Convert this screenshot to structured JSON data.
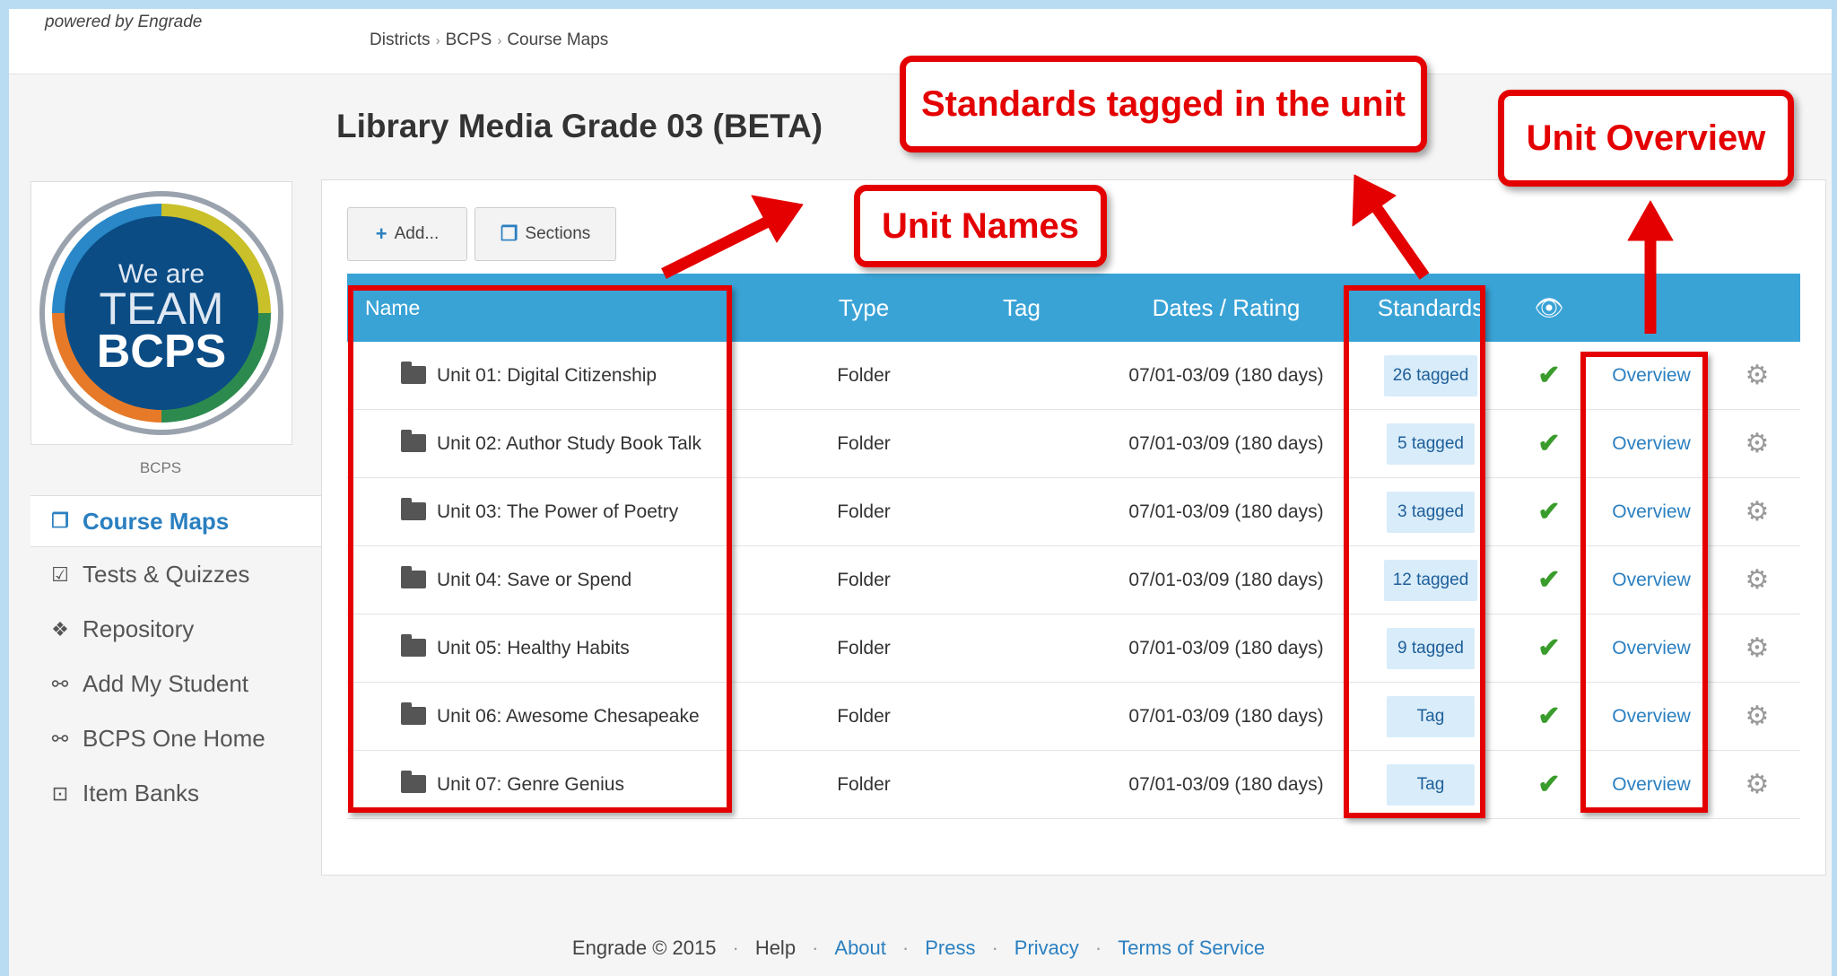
{
  "powered_by": "powered by Engrade",
  "breadcrumb": {
    "items": [
      "Districts",
      "BCPS",
      "Course Maps"
    ]
  },
  "page_title": "Library Media Grade 03 (BETA)",
  "logo": {
    "line1": "We are",
    "line2": "TEAM",
    "line3": "BCPS",
    "caption": "BCPS"
  },
  "sidebar": {
    "items": [
      {
        "label": "Course Maps",
        "icon": "pages-icon",
        "active": true
      },
      {
        "label": "Tests & Quizzes",
        "icon": "checkbox-icon"
      },
      {
        "label": "Repository",
        "icon": "dropbox-icon"
      },
      {
        "label": "Add My Student",
        "icon": "link-icon"
      },
      {
        "label": "BCPS One Home",
        "icon": "link-icon"
      },
      {
        "label": "Item Banks",
        "icon": "safe-icon"
      }
    ]
  },
  "toolbar": {
    "add_label": "Add...",
    "sections_label": "Sections"
  },
  "table": {
    "headers": {
      "name": "Name",
      "type": "Type",
      "tag": "Tag",
      "dates": "Dates / Rating",
      "standards": "Standards"
    },
    "rows": [
      {
        "name": "Unit 01: Digital Citizenship",
        "type": "Folder",
        "tag": "",
        "dates": "07/01-03/09 (180 days)",
        "standards": "26 tagged",
        "link": "Overview"
      },
      {
        "name": "Unit 02: Author Study Book Talk",
        "type": "Folder",
        "tag": "",
        "dates": "07/01-03/09 (180 days)",
        "standards": "5 tagged",
        "link": "Overview"
      },
      {
        "name": "Unit 03: The Power of Poetry",
        "type": "Folder",
        "tag": "",
        "dates": "07/01-03/09 (180 days)",
        "standards": "3 tagged",
        "link": "Overview"
      },
      {
        "name": "Unit 04: Save or Spend",
        "type": "Folder",
        "tag": "",
        "dates": "07/01-03/09 (180 days)",
        "standards": "12 tagged",
        "link": "Overview"
      },
      {
        "name": "Unit 05: Healthy Habits",
        "type": "Folder",
        "tag": "",
        "dates": "07/01-03/09 (180 days)",
        "standards": "9 tagged",
        "link": "Overview"
      },
      {
        "name": "Unit 06: Awesome Chesapeake",
        "type": "Folder",
        "tag": "",
        "dates": "07/01-03/09 (180 days)",
        "standards": "Tag",
        "link": "Overview"
      },
      {
        "name": "Unit 07: Genre Genius",
        "type": "Folder",
        "tag": "",
        "dates": "07/01-03/09 (180 days)",
        "standards": "Tag",
        "link": "Overview"
      }
    ]
  },
  "annotations": {
    "standards": "Standards tagged in the unit",
    "overview": "Unit Overview",
    "unit_names": "Unit Names"
  },
  "footer": {
    "copyright": "Engrade © 2015",
    "links": [
      "Help",
      "About",
      "Press",
      "Privacy",
      "Terms of Service"
    ]
  },
  "colors": {
    "accent": "#3aa3d6",
    "link": "#2a7fc0",
    "annotation": "#e40000",
    "check": "#3a9c2c"
  }
}
